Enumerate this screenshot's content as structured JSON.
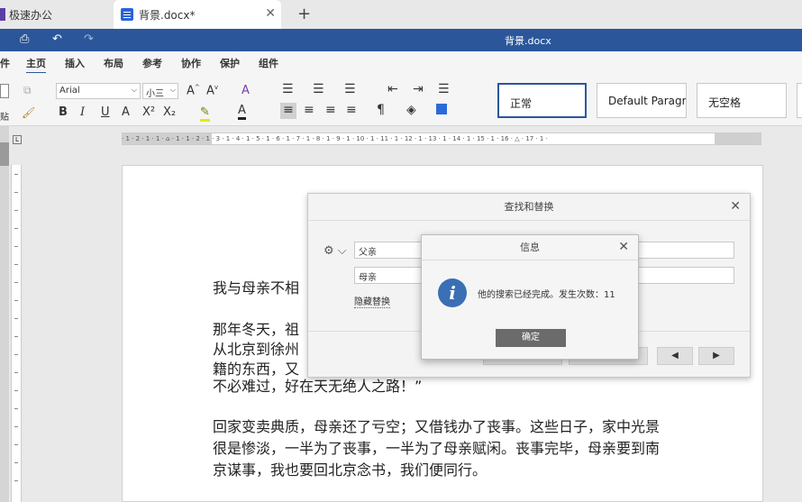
{
  "tabs": [
    {
      "label": "极速办公"
    },
    {
      "label": "背景.docx*"
    }
  ],
  "window": {
    "title": "背景.docx"
  },
  "menu": [
    "件",
    "主页",
    "插入",
    "布局",
    "参考",
    "协作",
    "保护",
    "组件"
  ],
  "ribbon": {
    "font_name": "Arial",
    "font_size": "小三",
    "paste_label": "贴",
    "styles": [
      "正常",
      "Default Paragraph",
      "无空格"
    ]
  },
  "ruler": {
    "marks": "· 1 · 2 · 1 · 1 · ⌂ · 1 · 1 · 2 · 1 · 3 · 1 · 4 · 1 · 5 · 1 · 6 · 1 · 7 · 1 · 8 · 1 · 9 · 1 · 10 · 1 · 11 · 1 · 12 · 1 · 13 · 1 · 14 · 1 · 15 · 1 · 16 · △ · 17 · 1 ·"
  },
  "document": {
    "lines": [
      "我与母亲不相",
      "那年冬天，祖",
      "从北京到徐州",
      "籍的东西，又",
      "不必难过，好在天无绝人之路！”",
      "回家变卖典质，母亲还了亏空；又借钱办了丧事。这些日子，家中光景",
      "很是惨淡，一半为了丧事，一半为了母亲赋闲。丧事完毕，母亲要到南",
      "京谋事，我也要回北京念书，我们便同行。"
    ]
  },
  "find_replace": {
    "title": "查找和替换",
    "find_value": "父亲",
    "replace_value": "母亲",
    "hide_replace_label": "隐藏替换",
    "prev_glyph": "◀",
    "next_glyph": "▶"
  },
  "info_dialog": {
    "title": "信息",
    "message": "他的搜索已经完成。发生次数：11",
    "ok_label": "确定",
    "icon_glyph": "i"
  }
}
